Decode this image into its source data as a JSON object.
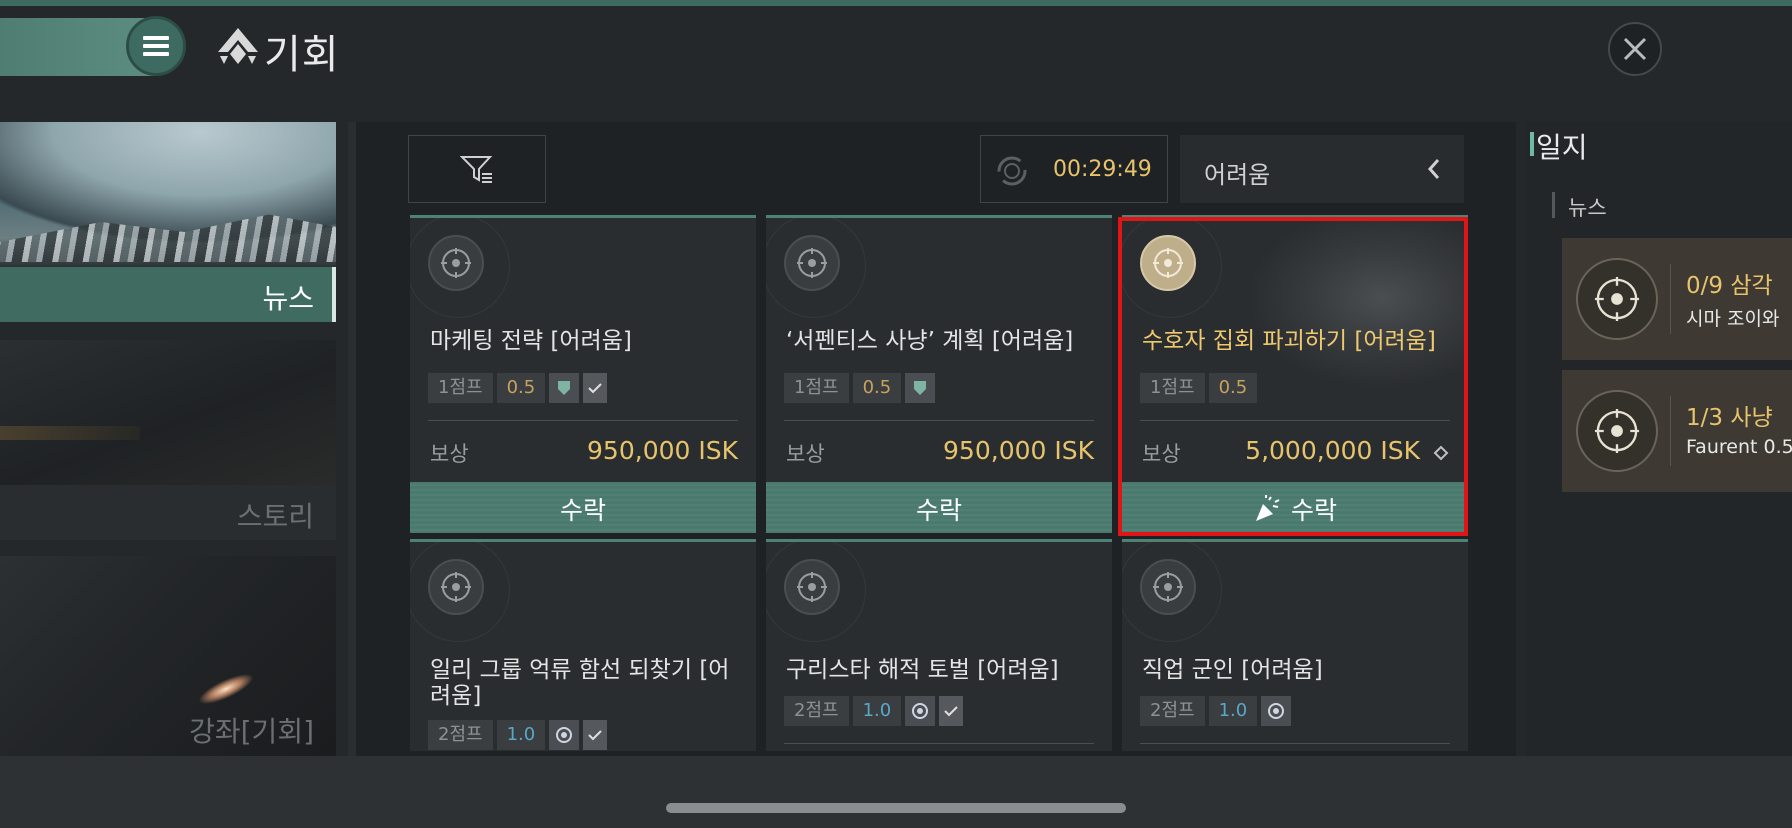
{
  "header": {
    "title": "기회"
  },
  "nav": [
    {
      "label": "뉴스"
    },
    {
      "label": "스토리"
    },
    {
      "label": "강좌[기회]"
    }
  ],
  "toolbar": {
    "timer": "00:29:49",
    "difficulty": "어려움"
  },
  "cards": [
    {
      "title": "마케팅 전략 [어려움]",
      "jumps": "1점프",
      "security": "0.5",
      "reward_label": "보상",
      "reward": "950,000 ISK",
      "accept": "수락"
    },
    {
      "title": "‘서펜티스 사냥’ 계획 [어려움]",
      "jumps": "1점프",
      "security": "0.5",
      "reward_label": "보상",
      "reward": "950,000 ISK",
      "accept": "수락"
    },
    {
      "title": "수호자 집회 파괴하기 [어려움]",
      "jumps": "1점프",
      "security": "0.5",
      "reward_label": "보상",
      "reward": "5,000,000 ISK",
      "accept": "수락"
    },
    {
      "title": "일리 그룹 억류 함선 되찾기 [어려움]",
      "jumps": "2점프",
      "security": "1.0"
    },
    {
      "title": "구리스타 해적 토벌 [어려움]",
      "jumps": "2점프",
      "security": "1.0"
    },
    {
      "title": "직업 군인 [어려움]",
      "jumps": "2점프",
      "security": "1.0"
    }
  ],
  "journal": {
    "title": "일지",
    "section": "뉴스",
    "entries": [
      {
        "progress": "0/9 삼각 ",
        "subtitle": "시마 조이와"
      },
      {
        "progress": "1/3 사냥 ",
        "subtitle": "Faurent 0.5"
      }
    ]
  },
  "colors": {
    "accent": "#4a7a6e",
    "reward_gold": "#e7c36c",
    "highlight": "#e01515"
  }
}
